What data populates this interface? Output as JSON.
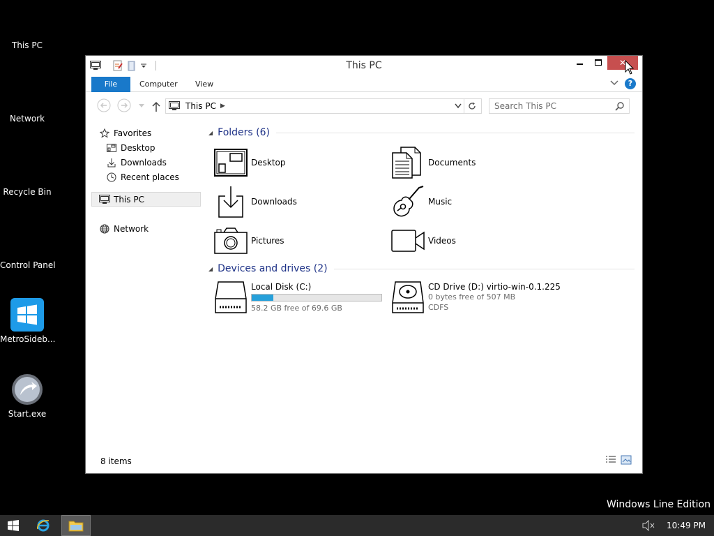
{
  "desktop": {
    "icons": [
      {
        "label": "This PC"
      },
      {
        "label": "Network"
      },
      {
        "label": "Recycle Bin"
      },
      {
        "label": "Control Panel"
      },
      {
        "label": "MetroSideb..."
      },
      {
        "label": "Start.exe"
      }
    ],
    "edition_text": "Windows Line Edition"
  },
  "window": {
    "title": "This PC",
    "close_glyph": "✕",
    "ribbon": {
      "tabs": [
        "File",
        "Computer",
        "View"
      ],
      "help": "?"
    },
    "address": {
      "path": "This PC",
      "search_placeholder": "Search This PC"
    },
    "nav": {
      "favorites": "Favorites",
      "desktop": "Desktop",
      "downloads": "Downloads",
      "recent": "Recent places",
      "this_pc": "This PC",
      "network": "Network"
    },
    "folders": {
      "header": "Folders (6)",
      "items": [
        "Desktop",
        "Documents",
        "Downloads",
        "Music",
        "Pictures",
        "Videos"
      ]
    },
    "drives": {
      "header": "Devices and drives (2)",
      "local": {
        "name": "Local Disk (C:)",
        "free": "58.2 GB free of 69.6 GB",
        "used_fraction": 0.164
      },
      "cd": {
        "name": "CD Drive (D:) virtio-win-0.1.225",
        "free": "0 bytes free of 507 MB",
        "fs": "CDFS"
      }
    },
    "status": "8 items"
  },
  "taskbar": {
    "clock": "10:49 PM"
  },
  "colors": {
    "accent": "#1979ca",
    "close": "#c74f4f",
    "progress": "#26a0da",
    "group_header": "#1e3287"
  }
}
